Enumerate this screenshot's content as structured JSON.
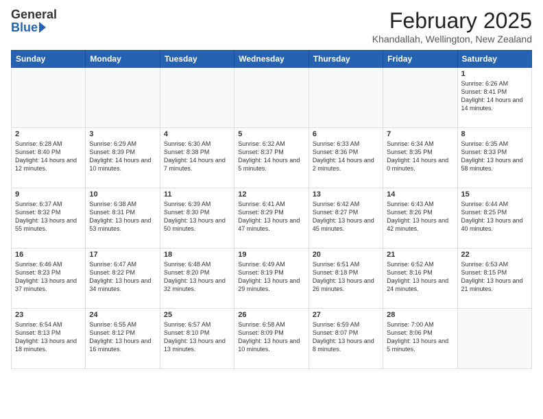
{
  "header": {
    "logo": {
      "general": "General",
      "blue": "Blue"
    },
    "title": "February 2025",
    "location": "Khandallah, Wellington, New Zealand"
  },
  "weekdays": [
    "Sunday",
    "Monday",
    "Tuesday",
    "Wednesday",
    "Thursday",
    "Friday",
    "Saturday"
  ],
  "weeks": [
    [
      {
        "day": "",
        "info": ""
      },
      {
        "day": "",
        "info": ""
      },
      {
        "day": "",
        "info": ""
      },
      {
        "day": "",
        "info": ""
      },
      {
        "day": "",
        "info": ""
      },
      {
        "day": "",
        "info": ""
      },
      {
        "day": "1",
        "info": "Sunrise: 6:26 AM\nSunset: 8:41 PM\nDaylight: 14 hours and 14 minutes."
      }
    ],
    [
      {
        "day": "2",
        "info": "Sunrise: 6:28 AM\nSunset: 8:40 PM\nDaylight: 14 hours and 12 minutes."
      },
      {
        "day": "3",
        "info": "Sunrise: 6:29 AM\nSunset: 8:39 PM\nDaylight: 14 hours and 10 minutes."
      },
      {
        "day": "4",
        "info": "Sunrise: 6:30 AM\nSunset: 8:38 PM\nDaylight: 14 hours and 7 minutes."
      },
      {
        "day": "5",
        "info": "Sunrise: 6:32 AM\nSunset: 8:37 PM\nDaylight: 14 hours and 5 minutes."
      },
      {
        "day": "6",
        "info": "Sunrise: 6:33 AM\nSunset: 8:36 PM\nDaylight: 14 hours and 2 minutes."
      },
      {
        "day": "7",
        "info": "Sunrise: 6:34 AM\nSunset: 8:35 PM\nDaylight: 14 hours and 0 minutes."
      },
      {
        "day": "8",
        "info": "Sunrise: 6:35 AM\nSunset: 8:33 PM\nDaylight: 13 hours and 58 minutes."
      }
    ],
    [
      {
        "day": "9",
        "info": "Sunrise: 6:37 AM\nSunset: 8:32 PM\nDaylight: 13 hours and 55 minutes."
      },
      {
        "day": "10",
        "info": "Sunrise: 6:38 AM\nSunset: 8:31 PM\nDaylight: 13 hours and 53 minutes."
      },
      {
        "day": "11",
        "info": "Sunrise: 6:39 AM\nSunset: 8:30 PM\nDaylight: 13 hours and 50 minutes."
      },
      {
        "day": "12",
        "info": "Sunrise: 6:41 AM\nSunset: 8:29 PM\nDaylight: 13 hours and 47 minutes."
      },
      {
        "day": "13",
        "info": "Sunrise: 6:42 AM\nSunset: 8:27 PM\nDaylight: 13 hours and 45 minutes."
      },
      {
        "day": "14",
        "info": "Sunrise: 6:43 AM\nSunset: 8:26 PM\nDaylight: 13 hours and 42 minutes."
      },
      {
        "day": "15",
        "info": "Sunrise: 6:44 AM\nSunset: 8:25 PM\nDaylight: 13 hours and 40 minutes."
      }
    ],
    [
      {
        "day": "16",
        "info": "Sunrise: 6:46 AM\nSunset: 8:23 PM\nDaylight: 13 hours and 37 minutes."
      },
      {
        "day": "17",
        "info": "Sunrise: 6:47 AM\nSunset: 8:22 PM\nDaylight: 13 hours and 34 minutes."
      },
      {
        "day": "18",
        "info": "Sunrise: 6:48 AM\nSunset: 8:20 PM\nDaylight: 13 hours and 32 minutes."
      },
      {
        "day": "19",
        "info": "Sunrise: 6:49 AM\nSunset: 8:19 PM\nDaylight: 13 hours and 29 minutes."
      },
      {
        "day": "20",
        "info": "Sunrise: 6:51 AM\nSunset: 8:18 PM\nDaylight: 13 hours and 26 minutes."
      },
      {
        "day": "21",
        "info": "Sunrise: 6:52 AM\nSunset: 8:16 PM\nDaylight: 13 hours and 24 minutes."
      },
      {
        "day": "22",
        "info": "Sunrise: 6:53 AM\nSunset: 8:15 PM\nDaylight: 13 hours and 21 minutes."
      }
    ],
    [
      {
        "day": "23",
        "info": "Sunrise: 6:54 AM\nSunset: 8:13 PM\nDaylight: 13 hours and 18 minutes."
      },
      {
        "day": "24",
        "info": "Sunrise: 6:55 AM\nSunset: 8:12 PM\nDaylight: 13 hours and 16 minutes."
      },
      {
        "day": "25",
        "info": "Sunrise: 6:57 AM\nSunset: 8:10 PM\nDaylight: 13 hours and 13 minutes."
      },
      {
        "day": "26",
        "info": "Sunrise: 6:58 AM\nSunset: 8:09 PM\nDaylight: 13 hours and 10 minutes."
      },
      {
        "day": "27",
        "info": "Sunrise: 6:59 AM\nSunset: 8:07 PM\nDaylight: 13 hours and 8 minutes."
      },
      {
        "day": "28",
        "info": "Sunrise: 7:00 AM\nSunset: 8:06 PM\nDaylight: 13 hours and 5 minutes."
      },
      {
        "day": "",
        "info": ""
      }
    ]
  ]
}
